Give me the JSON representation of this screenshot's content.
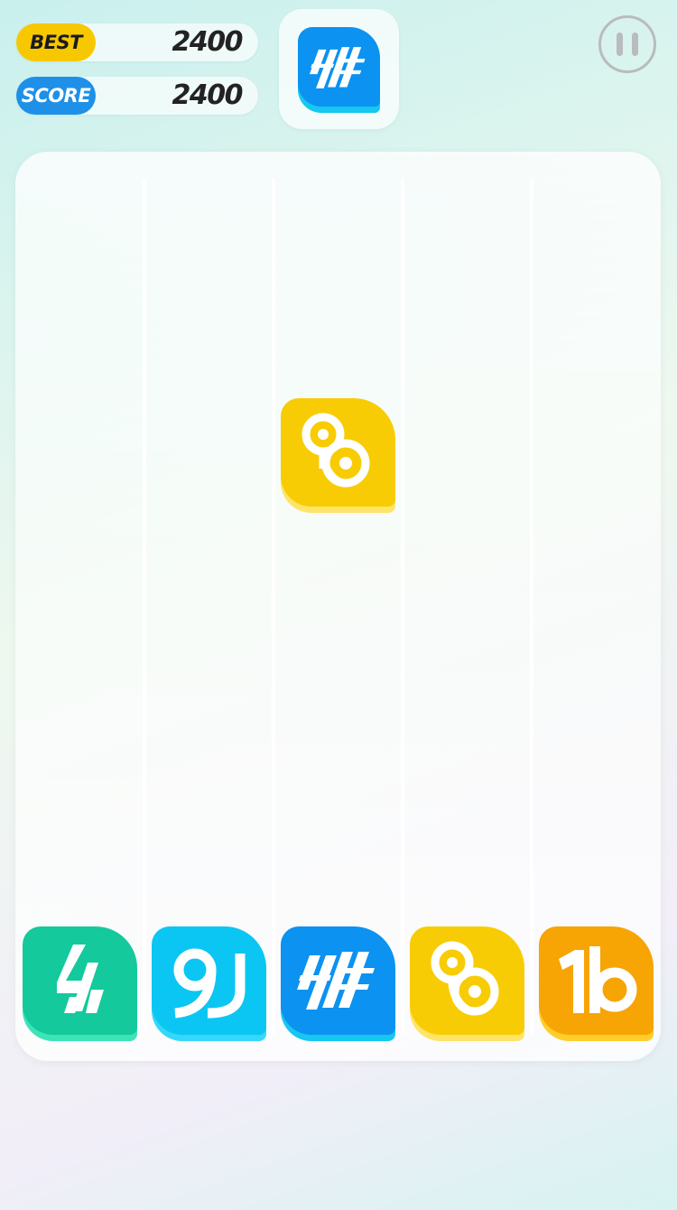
{
  "hud": {
    "best_label": "BEST",
    "best_value": "2400",
    "score_label": "SCORE",
    "score_value": "2400"
  },
  "colors": {
    "best_tag": "#f7c800",
    "score_tag": "#1e90e8",
    "green_tile": "#14c99b",
    "cyan_tile": "#0bc6f3",
    "blue_tile": "#0c92f0",
    "yellow_tile": "#f8cc05",
    "orange_tile": "#f7a405"
  },
  "next_piece": {
    "icon": "hf-glyph-icon",
    "color": "blue"
  },
  "falling_piece": {
    "icon": "link-glyph-icon",
    "color": "yellow",
    "column": 3
  },
  "bottom_row": [
    {
      "icon": "lightning-glyph-icon",
      "color": "green"
    },
    {
      "icon": "9j-glyph-icon",
      "color": "cyan"
    },
    {
      "icon": "hf-glyph-icon",
      "color": "blue"
    },
    {
      "icon": "link-glyph-icon",
      "color": "yellow"
    },
    {
      "icon": "1b-glyph-icon",
      "color": "orange"
    }
  ],
  "controls": {
    "pause_icon": "pause-icon"
  }
}
